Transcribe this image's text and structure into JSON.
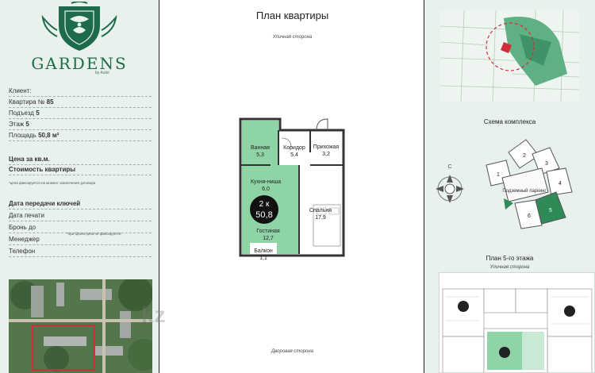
{
  "brand": {
    "name": "GARDENS",
    "sub": "by Aulet"
  },
  "apartment_info": {
    "client_label": "Клиент:",
    "apartment_label": "Квартира №",
    "apartment_value": "85",
    "entrance_label": "Подъезд",
    "entrance_value": "5",
    "floor_label": "Этаж",
    "floor_value": "5",
    "area_label": "Площадь",
    "area_value": "50,8 м²",
    "price_per_sqm_label": "Цена за кв.м.",
    "total_price_label": "Стоимость квартиры",
    "price_note": "*цена фиксируется на момент заключения договора",
    "handover_label": "Дата передачи ключей",
    "print_date_label": "Дата печати",
    "booking_label": "Бронь до",
    "booking_note": "*при брони цена не фиксируется",
    "manager_label": "Менеджер",
    "phone_label": "Телефон"
  },
  "plan": {
    "title": "План квартиры",
    "street_top": "Уличная сторона",
    "street_bottom": "Дворовая сторона",
    "rooms": [
      {
        "name": "Ванная",
        "area": "5,3"
      },
      {
        "name": "Коридор",
        "area": "5,4"
      },
      {
        "name": "Прихожая",
        "area": "3,2"
      },
      {
        "name": "Кухня-ниша",
        "area": "6,0"
      },
      {
        "name": "Спальня",
        "area": "17,9"
      },
      {
        "name": "Гостиная",
        "area": "12,7"
      },
      {
        "name": "Балкон",
        "area": "1,1"
      }
    ],
    "badge_type": "2 к",
    "badge_area": "50,8"
  },
  "complex": {
    "title": "Схема комплекса",
    "parking": "Подземный паркинг",
    "blocks": [
      "1",
      "2",
      "3",
      "4",
      "5",
      "6"
    ],
    "highlight_block": "5",
    "compass": "С"
  },
  "floor_plan": {
    "title": "План 5-го этажа",
    "street": "Уличная сторона"
  },
  "watermark": "kz",
  "colors": {
    "accent": "#1e6a4c",
    "room_fill": "#8fd4a6",
    "highlight": "#2e8b57",
    "panel_bg": "#e8f1ec"
  }
}
